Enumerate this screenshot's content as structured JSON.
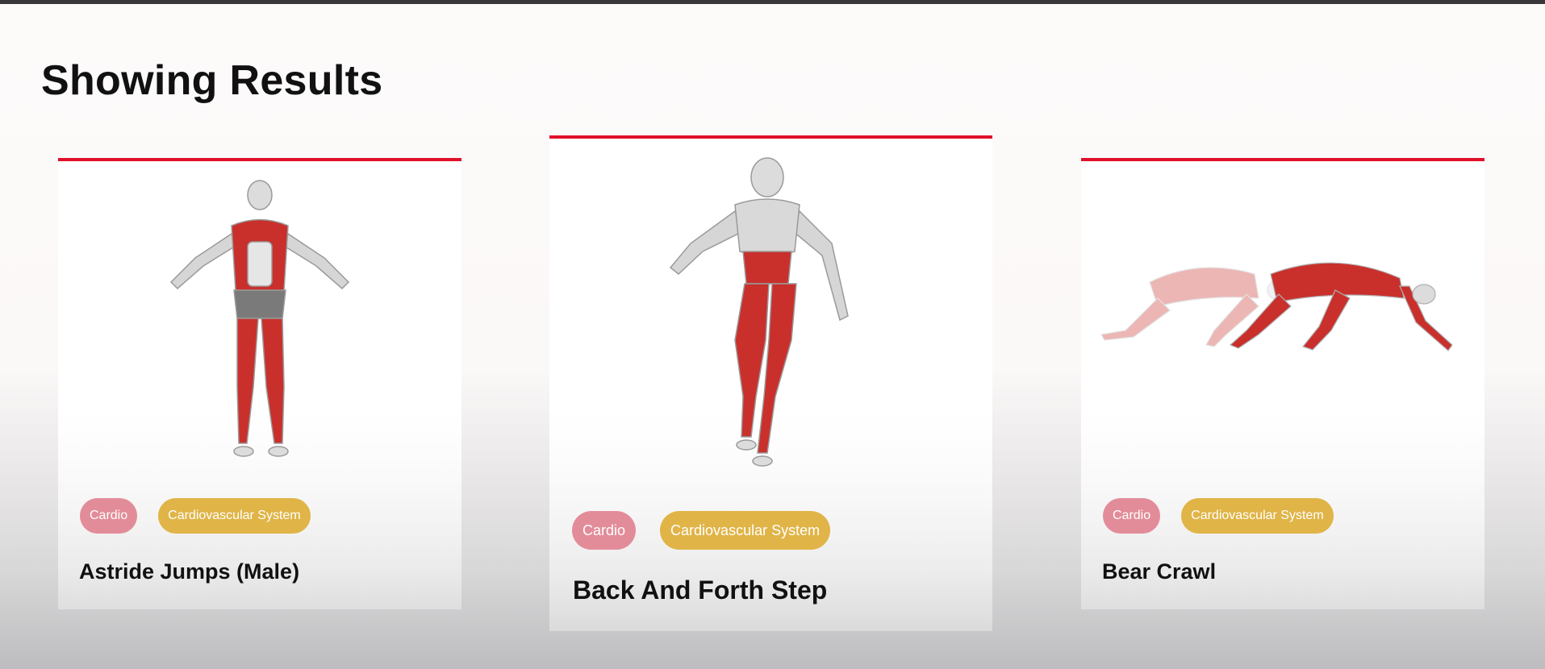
{
  "page": {
    "title": "Showing Results"
  },
  "accent_color": "#e0102a",
  "tag_colors": {
    "body_part": "#e38c99",
    "target": "#e0b447"
  },
  "results": [
    {
      "name": "Astride Jumps (Male)",
      "body_part": "Cardio",
      "target": "Cardiovascular System",
      "image_icon": "muscle-figure-jumping"
    },
    {
      "name": "Back And Forth Step",
      "body_part": "Cardio",
      "target": "Cardiovascular System",
      "image_icon": "muscle-figure-stepping"
    },
    {
      "name": "Bear Crawl",
      "body_part": "Cardio",
      "target": "Cardiovascular System",
      "image_icon": "muscle-figure-crawling"
    }
  ]
}
